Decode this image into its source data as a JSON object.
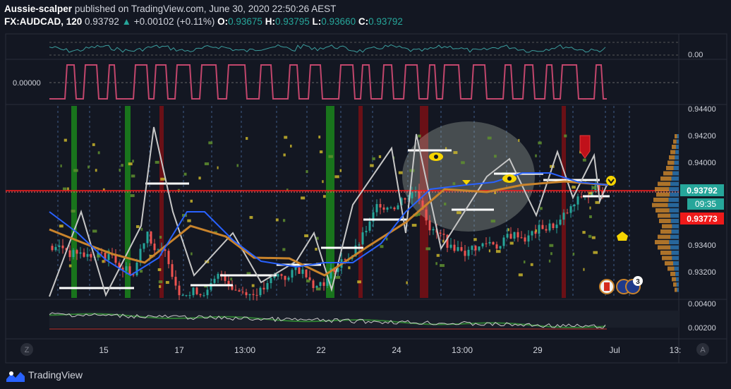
{
  "header": {
    "publisher": "Aussie-scalper",
    "published_text": "published on TradingView.com, June 30, 2020 22:50:26 AEST",
    "symbol": "FX:AUDCAD, 120",
    "last": "0.93792",
    "change_arrow": "▲",
    "change": "+0.00102 (+0.11%)",
    "o_label": "O:",
    "o": "0.93675",
    "h_label": "H:",
    "h": "0.93795",
    "l_label": "L:",
    "l": "0.93660",
    "c_label": "C:",
    "c": "0.93792"
  },
  "panes": {
    "top_oscillator_value": "0.00",
    "binary_indicator_value": "0.00000",
    "price_axis_ticks": [
      "0.94400",
      "0.94200",
      "0.94000",
      "0.93400",
      "0.93200"
    ],
    "price_badges": {
      "current": "0.93792",
      "countdown": "09:35",
      "red": "0.93773"
    },
    "bottom_axis_ticks": [
      "0.00400",
      "0.00200"
    ]
  },
  "time_axis": [
    "15",
    "17",
    "13:00",
    "22",
    "24",
    "13:00",
    "29",
    "Jul",
    "13:"
  ],
  "corner_labels": {
    "left": "Z",
    "right": "A"
  },
  "event_badge_count": "3",
  "colors": {
    "background": "#131722",
    "up": "#26a69a",
    "down": "#ef5350",
    "red_line": "#ff1a1a",
    "ma_brown": "#c9842c",
    "ma_blue": "#2962ff",
    "pink": "#c2466c",
    "cyan": "#3b9d9d",
    "green_band": "#1b8c1b",
    "red_band": "#7a0f14",
    "level": "#ffffff",
    "volume_profile": "#c9842c"
  },
  "footer": {
    "brand": "TradingView",
    "icon": "tradingview-logo-icon"
  },
  "chart_data": {
    "type": "line",
    "symbol": "FX:AUDCAD",
    "ylim": [
      0.9307,
      0.9447
    ],
    "x": [
      "15",
      "17",
      "13:00",
      "22",
      "24",
      "13:00",
      "29",
      "Jul"
    ],
    "series": [
      {
        "values": [
          0.934,
          0.942,
          0.9312,
          0.9325,
          0.942,
          0.9365,
          0.9395,
          0.938
        ]
      }
    ]
  }
}
